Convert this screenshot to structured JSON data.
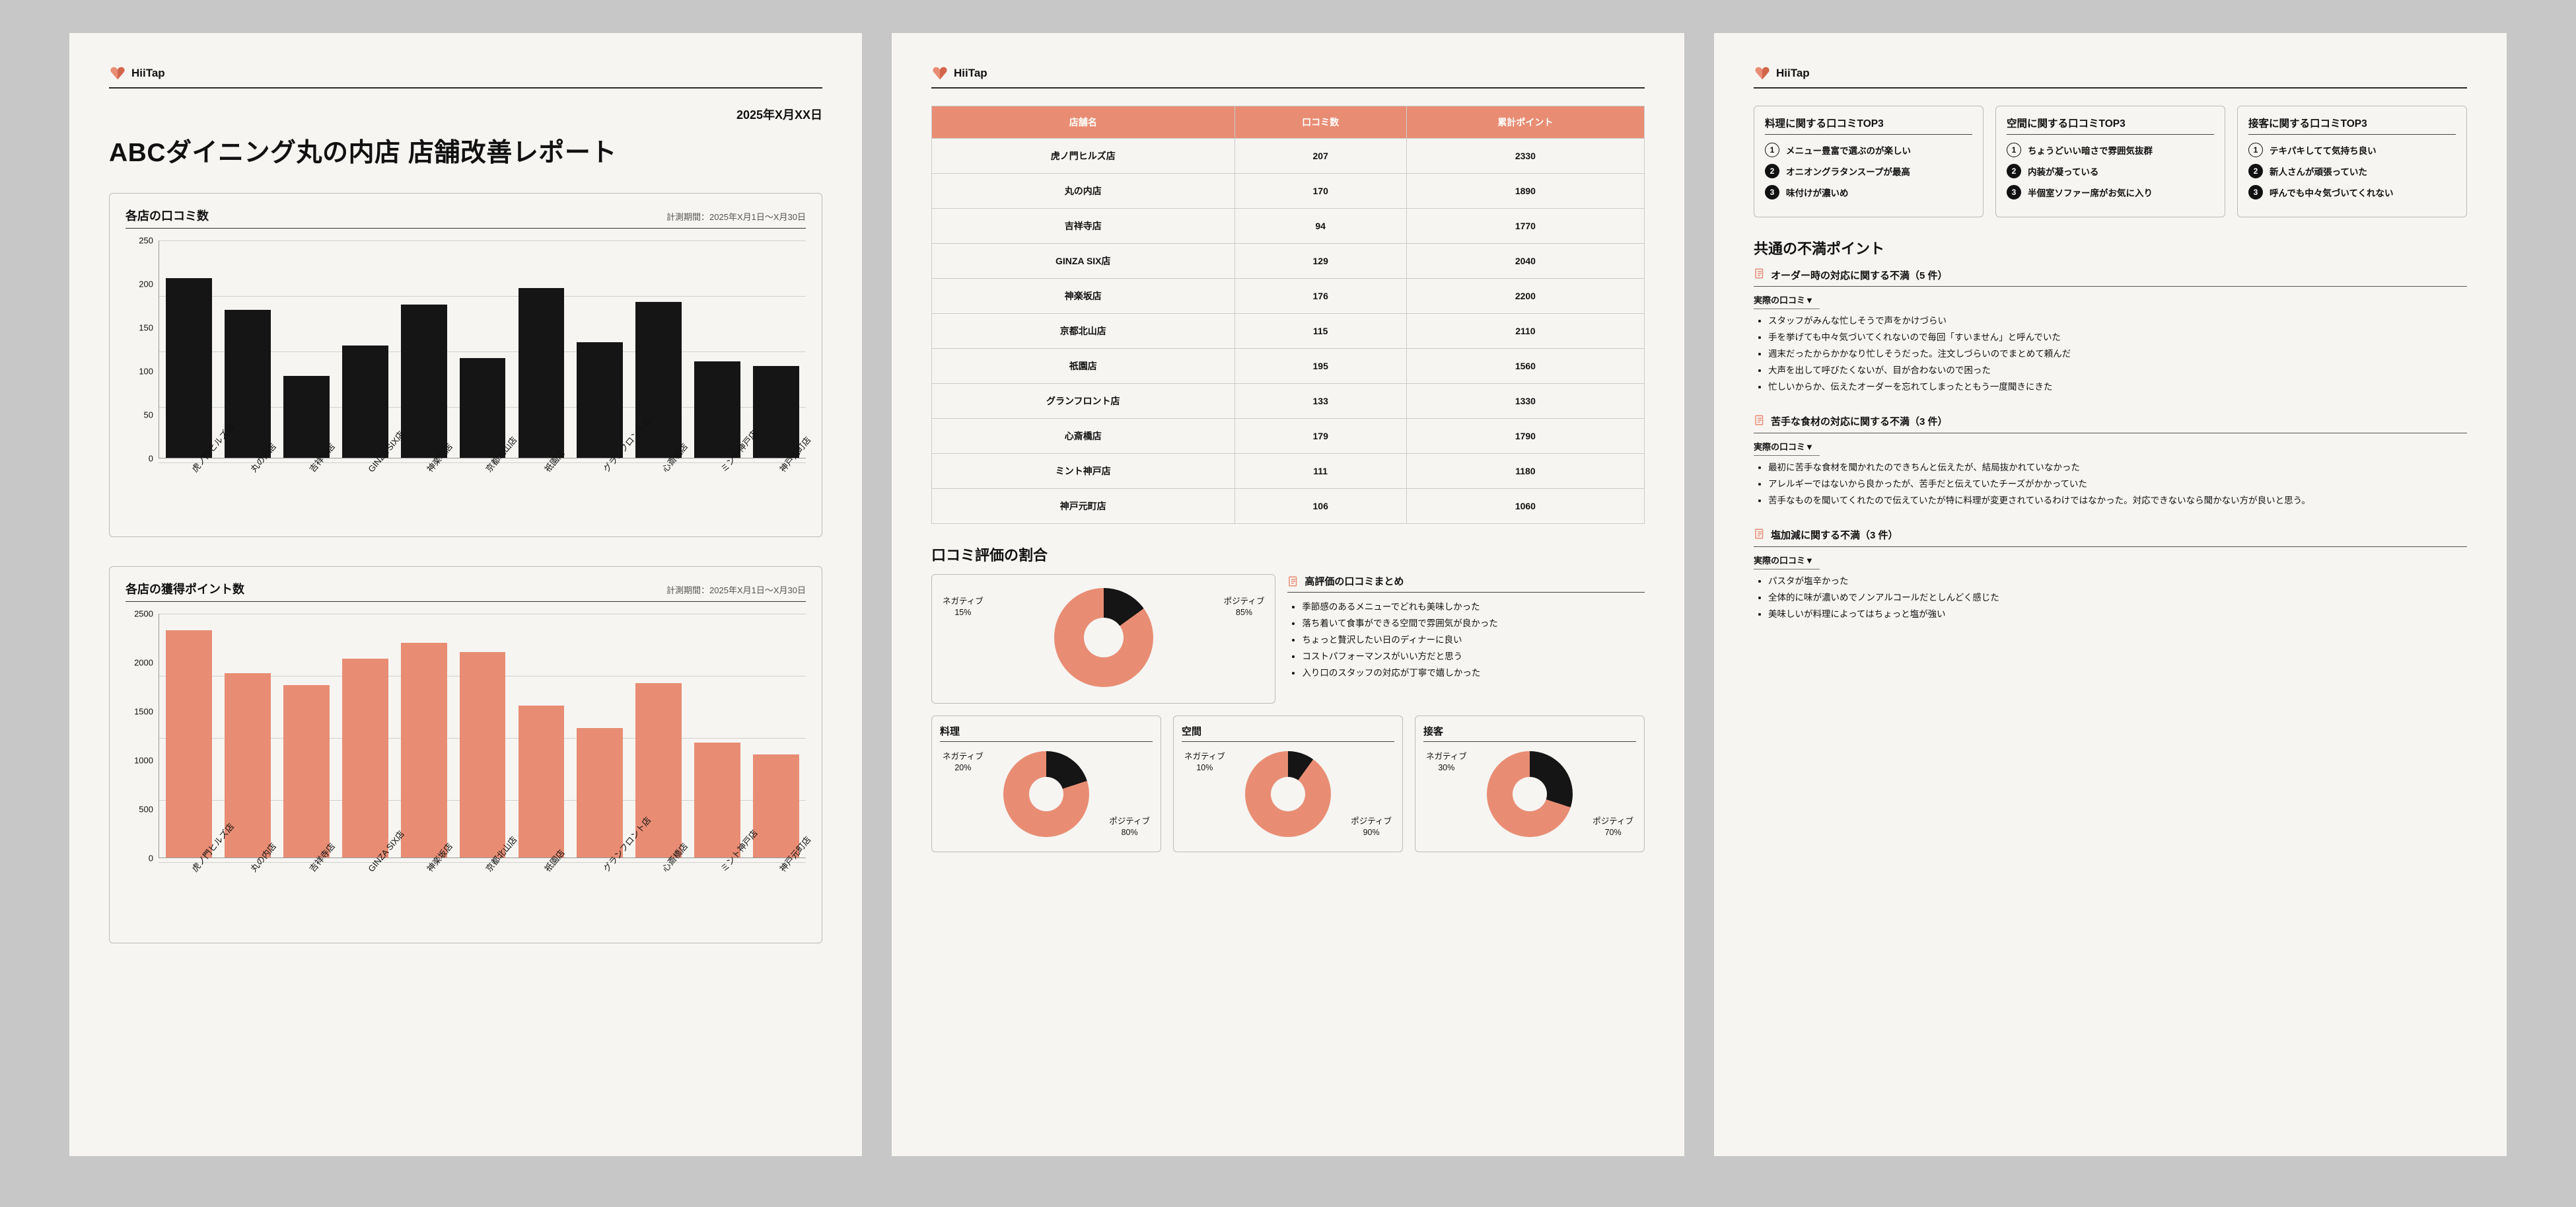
{
  "brand": "HiiTap",
  "doc_date": "2025年X月XX日",
  "main_title": "ABCダイニング丸の内店 店舗改善レポート",
  "chart1": {
    "title": "各店の口コミ数",
    "period": "計測期間：2025年X月1日〜X月30日"
  },
  "chart2": {
    "title": "各店の獲得ポイント数",
    "period": "計測期間：2025年X月1日〜X月30日"
  },
  "table": {
    "headers": [
      "店舗名",
      "口コミ数",
      "累計ポイント"
    ],
    "rows": [
      [
        "虎ノ門ヒルズ店",
        "207",
        "2330"
      ],
      [
        "丸の内店",
        "170",
        "1890"
      ],
      [
        "吉祥寺店",
        "94",
        "1770"
      ],
      [
        "GINZA SIX店",
        "129",
        "2040"
      ],
      [
        "神楽坂店",
        "176",
        "2200"
      ],
      [
        "京都北山店",
        "115",
        "2110"
      ],
      [
        "祇園店",
        "195",
        "1560"
      ],
      [
        "グランフロント店",
        "133",
        "1330"
      ],
      [
        "心斎橋店",
        "179",
        "1790"
      ],
      [
        "ミント神戸店",
        "111",
        "1180"
      ],
      [
        "神戸元町店",
        "106",
        "1060"
      ]
    ]
  },
  "ratio_heading": "口コミ評価の割合",
  "summary_title": "高評価の口コミまとめ",
  "summary_bullets": [
    "季節感のあるメニューでどれも美味しかった",
    "落ち着いて食事ができる空間で雰囲気が良かった",
    "ちょっと贅沢したい日のディナーに良い",
    "コストパフォーマンスがいい方だと思う",
    "入り口のスタッフの対応が丁寧で嬉しかった"
  ],
  "label_negative": "ネガティブ",
  "label_positive": "ポジティブ",
  "donuts": {
    "overall": {
      "neg": 15,
      "pos": 85
    },
    "food": {
      "title": "料理",
      "neg": 20,
      "pos": 80
    },
    "space": {
      "title": "空間",
      "neg": 10,
      "pos": 90
    },
    "service": {
      "title": "接客",
      "neg": 30,
      "pos": 70
    }
  },
  "top3": {
    "food": {
      "title": "料理に関する口コミTOP3",
      "items": [
        "メニュー豊富で選ぶのが楽しい",
        "オニオングラタンスープが最高",
        "味付けが濃いめ"
      ]
    },
    "space": {
      "title": "空間に関する口コミTOP3",
      "items": [
        "ちょうどいい暗さで雰囲気抜群",
        "内装が凝っている",
        "半個室ソファー席がお気に入り"
      ]
    },
    "service": {
      "title": "接客に関する口コミTOP3",
      "items": [
        "テキパキしてて気持ち良い",
        "新人さんが頑張っていた",
        "呼んでも中々気づいてくれない"
      ]
    }
  },
  "complaint_heading": "共通の不満ポイント",
  "actual_review_label": "実際の口コミ▼",
  "complaints": [
    {
      "title": "オーダー時の対応に関する不満（5 件）",
      "items": [
        "スタッフがみんな忙しそうで声をかけづらい",
        "手を挙げても中々気づいてくれないので毎回「すいません」と呼んでいた",
        "週末だったからかかなり忙しそうだった。注文しづらいのでまとめて頼んだ",
        "大声を出して呼びたくないが、目が合わないので困った",
        "忙しいからか、伝えたオーダーを忘れてしまったともう一度聞きにきた"
      ]
    },
    {
      "title": "苦手な食材の対応に関する不満（3 件）",
      "items": [
        "最初に苦手な食材を聞かれたのできちんと伝えたが、結局抜かれていなかった",
        "アレルギーではないから良かったが、苦手だと伝えていたチーズがかかっていた",
        "苦手なものを聞いてくれたので伝えていたが特に料理が変更されているわけではなかった。対応できないなら聞かない方が良いと思う。"
      ]
    },
    {
      "title": "塩加減に関する不満（3 件）",
      "items": [
        "パスタが塩辛かった",
        "全体的に味が濃いめでノンアルコールだとしんどく感じた",
        "美味しいが料理によってはちょっと塩が強い"
      ]
    }
  ],
  "chart_data": [
    {
      "type": "bar",
      "title": "各店の口コミ数",
      "categories": [
        "虎ノ門ヒルズ店",
        "丸の内店",
        "吉祥寺店",
        "GINZA SIX店",
        "神楽坂店",
        "京都北山店",
        "祇園店",
        "グランフロント店",
        "心斎橋店",
        "ミント神戸店",
        "神戸元町店"
      ],
      "values": [
        207,
        170,
        94,
        129,
        176,
        115,
        195,
        133,
        179,
        111,
        106
      ],
      "ylim": [
        0,
        250
      ],
      "yticks": [
        0,
        50,
        100,
        150,
        200,
        250
      ],
      "color": "#151515"
    },
    {
      "type": "bar",
      "title": "各店の獲得ポイント数",
      "categories": [
        "虎ノ門ヒルズ店",
        "丸の内店",
        "吉祥寺店",
        "GINZA SIX店",
        "神楽坂店",
        "京都北山店",
        "祇園店",
        "グランフロント店",
        "心斎橋店",
        "ミント神戸店",
        "神戸元町店"
      ],
      "values": [
        2330,
        1890,
        1770,
        2040,
        2200,
        2110,
        1560,
        1330,
        1790,
        1180,
        1060
      ],
      "ylim": [
        0,
        2500
      ],
      "yticks": [
        0,
        500,
        1000,
        1500,
        2000,
        2500
      ],
      "color": "#e88d74"
    },
    {
      "type": "pie",
      "title": "口コミ評価の割合",
      "series": [
        {
          "name": "ポジティブ",
          "value": 85
        },
        {
          "name": "ネガティブ",
          "value": 15
        }
      ]
    },
    {
      "type": "pie",
      "title": "料理",
      "series": [
        {
          "name": "ポジティブ",
          "value": 80
        },
        {
          "name": "ネガティブ",
          "value": 20
        }
      ]
    },
    {
      "type": "pie",
      "title": "空間",
      "series": [
        {
          "name": "ポジティブ",
          "value": 90
        },
        {
          "name": "ネガティブ",
          "value": 10
        }
      ]
    },
    {
      "type": "pie",
      "title": "接客",
      "series": [
        {
          "name": "ポジティブ",
          "value": 70
        },
        {
          "name": "ネガティブ",
          "value": 30
        }
      ]
    }
  ]
}
